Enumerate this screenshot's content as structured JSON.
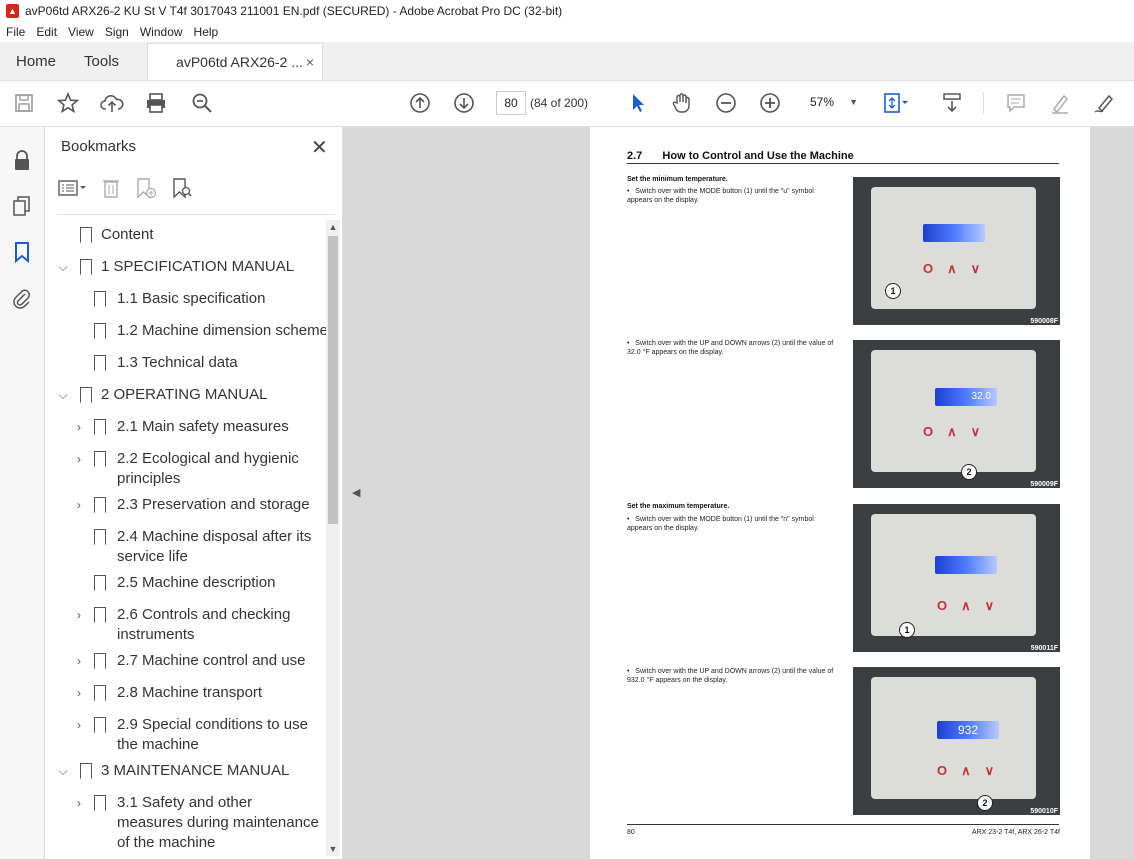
{
  "window": {
    "title": "avP06td ARX26-2 KU St V T4f 3017043 211001 EN.pdf (SECURED) - Adobe Acrobat Pro DC (32-bit)"
  },
  "menu": [
    "File",
    "Edit",
    "View",
    "Sign",
    "Window",
    "Help"
  ],
  "tabs": {
    "home": "Home",
    "tools": "Tools",
    "doc": "avP06td ARX26-2 ...",
    "close": "×"
  },
  "toolbar": {
    "page_number": "80",
    "page_count": "(84 of 200)",
    "zoom": "57%"
  },
  "bookmarks": {
    "title": "Bookmarks",
    "close": "✕",
    "items": [
      {
        "label": "Content"
      },
      {
        "label": "1 SPECIFICATION MANUAL"
      },
      {
        "label": "1.1 Basic specification"
      },
      {
        "label": "1.2 Machine dimension scheme"
      },
      {
        "label": "1.3 Technical data"
      },
      {
        "label": "2 OPERATING MANUAL"
      },
      {
        "label": "2.1 Main safety measures"
      },
      {
        "label": "2.2 Ecological and hygienic principles"
      },
      {
        "label": "2.3 Preservation and storage"
      },
      {
        "label": "2.4 Machine disposal after its service life"
      },
      {
        "label": "2.5 Machine description"
      },
      {
        "label": "2.6 Controls and checking instruments"
      },
      {
        "label": "2.7 Machine control and use"
      },
      {
        "label": "2.8 Machine transport"
      },
      {
        "label": "2.9 Special conditions to use the machine"
      },
      {
        "label": "3 MAINTENANCE MANUAL"
      },
      {
        "label": "3.1 Safety and other measures during maintenance of the machine"
      }
    ]
  },
  "document": {
    "section_number": "2.7",
    "section_title": "How to Control and Use the Machine",
    "blocks": [
      {
        "heading": "Set the minimum temperature.",
        "text": "Switch over with the MODE button (1) until the \"u\" symbol appears on the display.",
        "code": "590008F",
        "callout": "1"
      },
      {
        "heading": "",
        "text": "Switch over with the UP and DOWN arrows (2) until the value of 32.0 °F appears on the display.",
        "code": "590009F",
        "callout": "2",
        "display": "32.0"
      },
      {
        "heading": "Set the maximum temperature.",
        "text": "Switch over with the MODE button (1) until the \"n\" symbol appears on the display.",
        "code": "590011F",
        "callout": "1"
      },
      {
        "heading": "",
        "text": "Switch over with the UP and DOWN arrows (2) until the value of 932.0 °F appears on the display.",
        "code": "590010F",
        "callout": "2",
        "display": "932"
      }
    ],
    "page_number": "80",
    "model": "ARX 23-2 T4f, ARX 26-2 T4f"
  }
}
